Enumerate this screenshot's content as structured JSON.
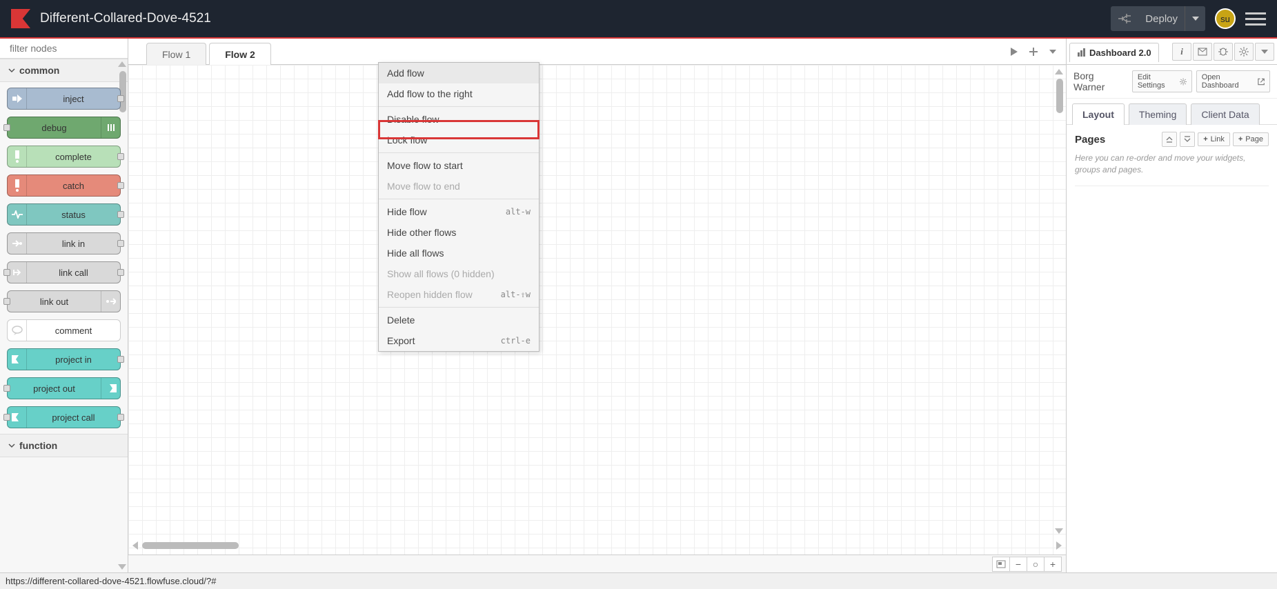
{
  "header": {
    "title": "Different-Collared-Dove-4521",
    "deploy_label": "Deploy",
    "avatar": "su"
  },
  "palette": {
    "filter_placeholder": "filter nodes",
    "categories": {
      "common": "common",
      "function": "function"
    },
    "nodes": {
      "inject": "inject",
      "debug": "debug",
      "complete": "complete",
      "catch": "catch",
      "status": "status",
      "link_in": "link in",
      "link_call": "link call",
      "link_out": "link out",
      "comment": "comment",
      "project_in": "project in",
      "project_out": "project out",
      "project_call": "project call"
    }
  },
  "workspace": {
    "tabs": {
      "flow1": "Flow 1",
      "flow2": "Flow 2"
    }
  },
  "context_menu": {
    "add_flow": "Add flow",
    "add_flow_right": "Add flow to the right",
    "disable_flow": "Disable flow",
    "lock_flow": "Lock flow",
    "move_start": "Move flow to start",
    "move_end": "Move flow to end",
    "hide_flow": "Hide flow",
    "hide_flow_kbd": "alt-w",
    "hide_other": "Hide other flows",
    "hide_all": "Hide all flows",
    "show_all": "Show all flows (0 hidden)",
    "reopen": "Reopen hidden flow",
    "reopen_kbd": "alt-⇧w",
    "delete": "Delete",
    "export": "Export",
    "export_kbd": "ctrl-e"
  },
  "sidebar": {
    "main_tab": "Dashboard 2.0",
    "title": "Borg Warner",
    "edit_settings": "Edit Settings",
    "open_dashboard": "Open Dashboard",
    "tabs": {
      "layout": "Layout",
      "theming": "Theming",
      "client_data": "Client Data"
    },
    "pages_label": "Pages",
    "link_btn": "Link",
    "page_btn": "Page",
    "hint": "Here you can re-order and move your widgets, groups and pages."
  },
  "status_bar": {
    "url": "https://different-collared-dove-4521.flowfuse.cloud/?#"
  }
}
